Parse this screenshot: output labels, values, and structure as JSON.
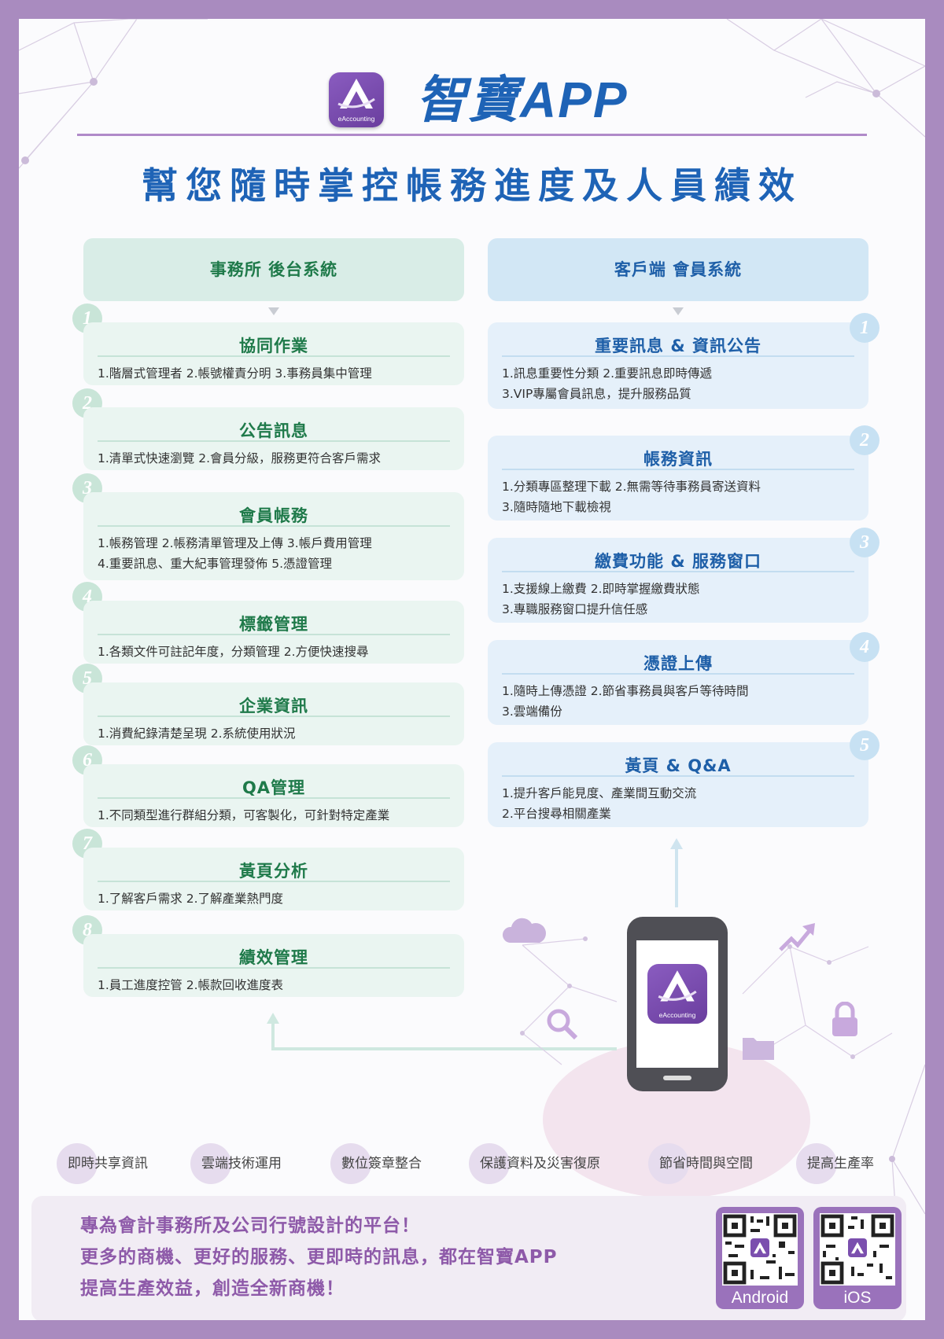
{
  "header": {
    "app_icon_caption": "eAccounting",
    "brand": "智寶APP",
    "subtitle": "幫您隨時掌控帳務進度及人員績效"
  },
  "left_column": {
    "heading": "事務所 後台系統",
    "cards": [
      {
        "number": "1",
        "title": "協同作業",
        "lines": [
          "1.階層式管理者 2.帳號權責分明 3.事務員集中管理"
        ]
      },
      {
        "number": "2",
        "title": "公告訊息",
        "lines": [
          "1.清單式快速瀏覽 2.會員分級，服務更符合客戶需求"
        ]
      },
      {
        "number": "3",
        "title": "會員帳務",
        "lines": [
          "1.帳務管理 2.帳務清單管理及上傳 3.帳戶費用管理",
          "4.重要訊息、重大紀事管理發佈 5.憑證管理"
        ]
      },
      {
        "number": "4",
        "title": "標籤管理",
        "lines": [
          "1.各類文件可註記年度，分類管理 2.方便快速搜尋"
        ]
      },
      {
        "number": "5",
        "title": "企業資訊",
        "lines": [
          "1.消費紀錄清楚呈現 2.系統使用狀況"
        ]
      },
      {
        "number": "6",
        "title": "QA管理",
        "lines": [
          "1.不同類型進行群組分類，可客製化，可針對特定產業"
        ]
      },
      {
        "number": "7",
        "title": "黃頁分析",
        "lines": [
          "1.了解客戶需求 2.了解產業熱門度"
        ]
      },
      {
        "number": "8",
        "title": "績效管理",
        "lines": [
          "1.員工進度控管 2.帳款回收進度表"
        ]
      }
    ]
  },
  "right_column": {
    "heading": "客戶端 會員系統",
    "cards": [
      {
        "number": "1",
        "title": "重要訊息 & 資訊公告",
        "lines": [
          "1.訊息重要性分類 2.重要訊息即時傳遞",
          "3.VIP專屬會員訊息，提升服務品質"
        ]
      },
      {
        "number": "2",
        "title": "帳務資訊",
        "lines": [
          "1.分類專區整理下載 2.無需等待事務員寄送資料",
          "3.隨時隨地下載檢視"
        ]
      },
      {
        "number": "3",
        "title": "繳費功能 & 服務窗口",
        "lines": [
          "1.支援線上繳費 2.即時掌握繳費狀態",
          "3.專職服務窗口提升信任感"
        ]
      },
      {
        "number": "4",
        "title": "憑證上傳",
        "lines": [
          "1.隨時上傳憑證 2.節省事務員與客戶等待時間",
          "3.雲端備份"
        ]
      },
      {
        "number": "5",
        "title": "黃頁 & Q&A",
        "lines": [
          "1.提升客戶能見度、產業間互動交流",
          "2.平台搜尋相關產業"
        ]
      }
    ]
  },
  "phone": {
    "icon_caption": "eAccounting"
  },
  "features": [
    "即時共享資訊",
    "雲端技術運用",
    "數位簽章整合",
    "保護資料及災害復原",
    "節省時間與空間",
    "提高生產率"
  ],
  "bottom": {
    "slogans": [
      "專為會計事務所及公司行號設計的平台！",
      "更多的商機、更好的服務、更即時的訊息，都在智寶APP",
      "提高生產效益，創造全新商機！"
    ],
    "qr": [
      {
        "label": "Android"
      },
      {
        "label": "iOS"
      }
    ]
  },
  "colors": {
    "frame": "#a98bbf",
    "brand_blue": "#1e63b6",
    "left_green": "#1f7a4a",
    "right_blue": "#1e5fa8",
    "purple": "#8e5aa9"
  },
  "icons": [
    "app-logo-icon",
    "cloud-icon",
    "search-icon",
    "folder-icon",
    "lock-icon",
    "trend-arrow-icon",
    "qr-code-icon"
  ]
}
